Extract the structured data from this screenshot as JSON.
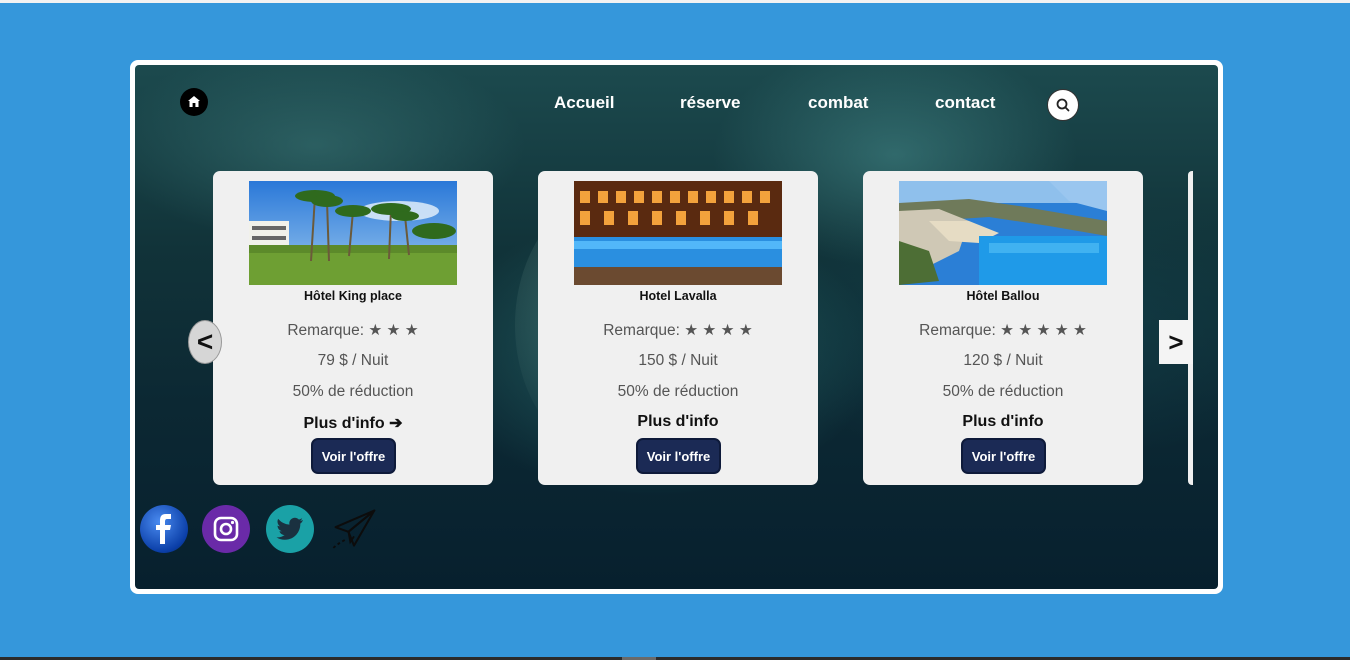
{
  "nav": {
    "links": [
      "Accueil",
      "réserve",
      "combat",
      "contact"
    ]
  },
  "cards": [
    {
      "name": "Hôtel King place",
      "rating_label": "Remarque:",
      "stars": "★ ★ ★",
      "star_count": 3,
      "price": "79 $ / Nuit",
      "discount": "50% de réduction",
      "more": "Plus d'info ➔",
      "offer_label": "Voir l'offre",
      "image": "palm-trees-hotel-garden"
    },
    {
      "name": "Hotel Lavalla",
      "rating_label": "Remarque:",
      "stars": "★ ★ ★ ★",
      "star_count": 4,
      "price": "150 $ / Nuit",
      "discount": "50% de réduction",
      "more": "Plus d'info",
      "offer_label": "Voir l'offre",
      "image": "night-pool-hotel"
    },
    {
      "name": "Hôtel Ballou",
      "rating_label": "Remarque:",
      "stars": "★ ★ ★ ★ ★",
      "star_count": 5,
      "price": "120 $ / Nuit",
      "discount": "50% de réduction",
      "more": "Plus d'info",
      "offer_label": "Voir l'offre",
      "image": "beach-cove-cliffs"
    }
  ],
  "carousel": {
    "prev": "<",
    "next": ">"
  },
  "social": [
    "facebook-icon",
    "instagram-icon",
    "twitter-icon",
    "paper-plane-icon"
  ],
  "colors": {
    "page_background": "#3597db",
    "card_background": "#f0f0f0",
    "offer_button": "#1b2a55",
    "twitter": "#1aa1a6",
    "instagram": "#6a2aa8"
  }
}
